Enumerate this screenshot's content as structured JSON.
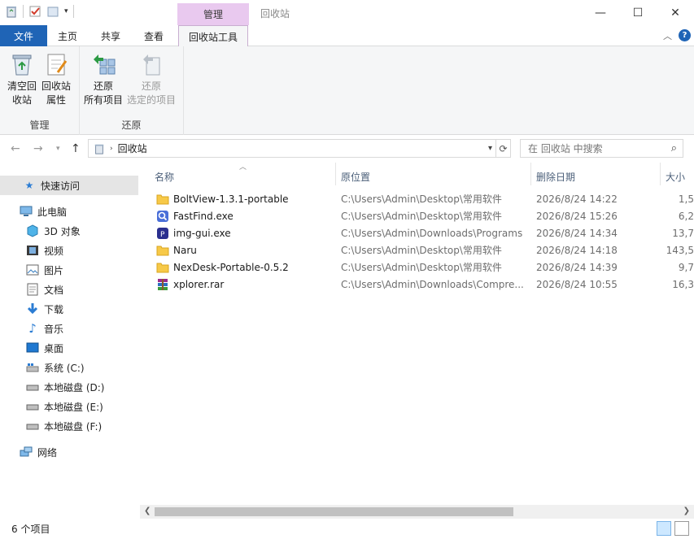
{
  "window": {
    "title": "回收站",
    "context_tab_header": "管理",
    "minimize": "—",
    "maximize": "☐",
    "close": "✕"
  },
  "tabs": {
    "file": "文件",
    "home": "主页",
    "share": "共享",
    "view": "查看",
    "tools": "回收站工具"
  },
  "ribbon": {
    "manage": {
      "label": "管理",
      "empty_line1": "清空回",
      "empty_line2": "收站",
      "props_line1": "回收站",
      "props_line2": "属性"
    },
    "restore": {
      "label": "还原",
      "all_line1": "还原",
      "all_line2": "所有项目",
      "sel_line1": "还原",
      "sel_line2": "选定的项目"
    }
  },
  "address": {
    "path": "回收站",
    "search_placeholder": "在 回收站 中搜索"
  },
  "nav": {
    "quick_access": "快速访问",
    "this_pc": "此电脑",
    "objects3d": "3D 对象",
    "videos": "视频",
    "pictures": "图片",
    "documents": "文档",
    "downloads": "下载",
    "music": "音乐",
    "desktop": "桌面",
    "drive_c": "系统 (C:)",
    "drive_d": "本地磁盘 (D:)",
    "drive_e": "本地磁盘 (E:)",
    "drive_f": "本地磁盘 (F:)",
    "network": "网络"
  },
  "columns": {
    "name": "名称",
    "original_location": "原位置",
    "date_deleted": "删除日期",
    "size": "大小"
  },
  "files": [
    {
      "name": "BoltView-1.3.1-portable",
      "orig": "C:\\Users\\Admin\\Desktop\\常用软件",
      "date": "2026/8/24 14:22",
      "size": "1,5"
    },
    {
      "name": "FastFind.exe",
      "orig": "C:\\Users\\Admin\\Desktop\\常用软件",
      "date": "2026/8/24 15:26",
      "size": "6,2"
    },
    {
      "name": "img-gui.exe",
      "orig": "C:\\Users\\Admin\\Downloads\\Programs",
      "date": "2026/8/24 14:34",
      "size": "13,7"
    },
    {
      "name": "Naru",
      "orig": "C:\\Users\\Admin\\Desktop\\常用软件",
      "date": "2026/8/24 14:18",
      "size": "143,5"
    },
    {
      "name": "NexDesk-Portable-0.5.2",
      "orig": "C:\\Users\\Admin\\Desktop\\常用软件",
      "date": "2026/8/24 14:39",
      "size": "9,7"
    },
    {
      "name": "xplorer.rar",
      "orig": "C:\\Users\\Admin\\Downloads\\Compre...",
      "date": "2026/8/24 10:55",
      "size": "16,3"
    }
  ],
  "status": {
    "count": "6 个项目"
  },
  "colors": {
    "accent": "#1f64b6",
    "context_tab": "#e9c9ef",
    "folder": "#f7c948"
  }
}
